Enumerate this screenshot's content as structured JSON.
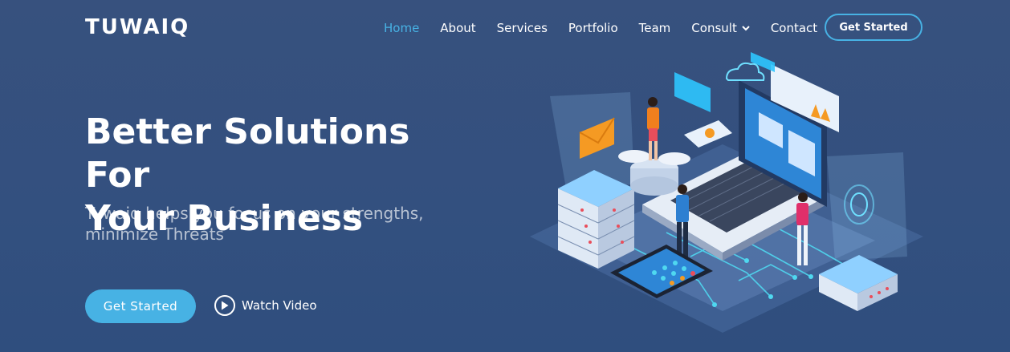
{
  "header": {
    "logo": "TUWAIQ",
    "nav": [
      {
        "label": "Home",
        "active": true
      },
      {
        "label": "About"
      },
      {
        "label": "Services"
      },
      {
        "label": "Portfolio"
      },
      {
        "label": "Team"
      },
      {
        "label": "Consult",
        "dropdown": true
      },
      {
        "label": "Contact"
      }
    ],
    "cta_label": "Get Started"
  },
  "hero": {
    "title_line1": "Better Solutions For",
    "title_line2": "Your Business",
    "subtitle_line1": "Tuwaiq helps you focus on your strengths,",
    "subtitle_line2": "minimize Threats",
    "primary_button": "Get Started",
    "video_button": "Watch Video",
    "illustration_icon": "laptop-network-illustration"
  },
  "colors": {
    "background": "#37517e",
    "accent": "#47b2e4",
    "text": "#ffffff"
  }
}
